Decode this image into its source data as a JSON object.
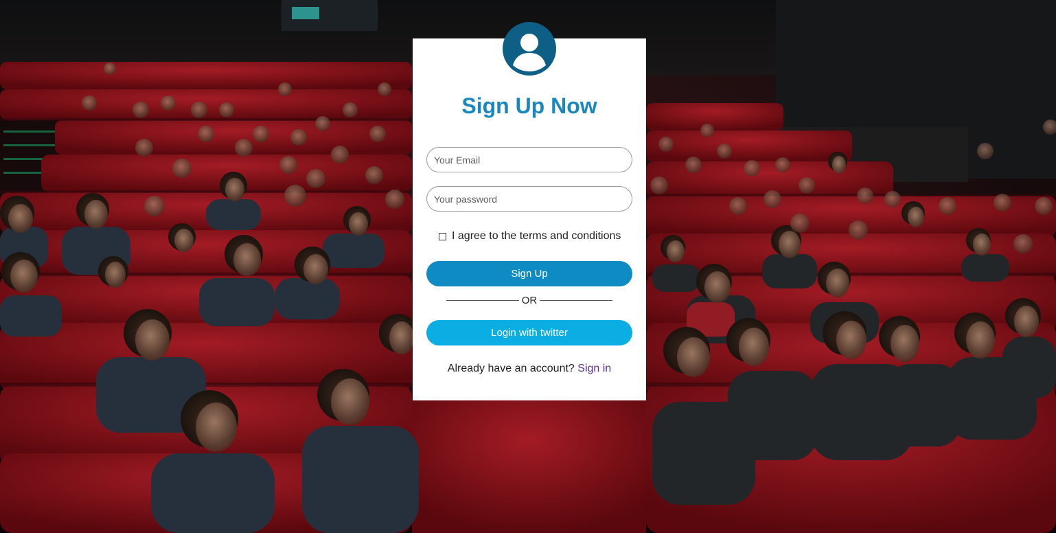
{
  "background": {
    "image": "cinema-audience-photo",
    "seat_color": "#b3151f"
  },
  "form": {
    "avatar_icon": "user-avatar-icon",
    "title": "Sign Up Now",
    "email_placeholder": "Your Email",
    "password_placeholder": "Your password",
    "terms_label": "I agree to the terms and conditions",
    "signup_label": "Sign Up",
    "or_label": "OR",
    "twitter_label": "Login with twitter",
    "already_text": "Already have an account?",
    "signin_label": "Sign in"
  },
  "colors": {
    "title": "#1b88bd",
    "avatar": "#0d5f85",
    "signup_button": "#0f8bc4",
    "twitter_button": "#0aaee3",
    "link": "#5a2d8c"
  }
}
